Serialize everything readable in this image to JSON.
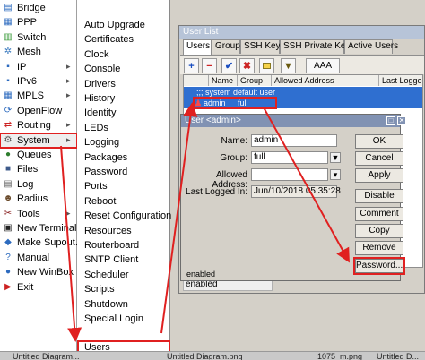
{
  "sidebar": {
    "items": [
      {
        "label": "Bridge",
        "icon": "bridge-icon",
        "glyph": "▤",
        "color": "#2d6bbf",
        "arrow": false
      },
      {
        "label": "PPP",
        "icon": "ppp-icon",
        "glyph": "▦",
        "color": "#2d6bbf",
        "arrow": false
      },
      {
        "label": "Switch",
        "icon": "switch-icon",
        "glyph": "▥",
        "color": "#3a9a3a",
        "arrow": false
      },
      {
        "label": "Mesh",
        "icon": "mesh-icon",
        "glyph": "✲",
        "color": "#3a7abf",
        "arrow": false
      },
      {
        "label": "IP",
        "icon": "ip-icon",
        "glyph": "▪",
        "color": "#2d6bbf",
        "arrow": true
      },
      {
        "label": "IPv6",
        "icon": "ipv6-icon",
        "glyph": "▪",
        "color": "#2d6bbf",
        "arrow": true
      },
      {
        "label": "MPLS",
        "icon": "mpls-icon",
        "glyph": "▦",
        "color": "#2d6bbf",
        "arrow": true
      },
      {
        "label": "OpenFlow",
        "icon": "openflow-icon",
        "glyph": "⟳",
        "color": "#2d6bbf",
        "arrow": false
      },
      {
        "label": "Routing",
        "icon": "routing-icon",
        "glyph": "⇄",
        "color": "#cc2222",
        "arrow": true
      },
      {
        "label": "System",
        "icon": "system-icon",
        "glyph": "⚙",
        "color": "#555555",
        "arrow": true
      },
      {
        "label": "Queues",
        "icon": "queues-icon",
        "glyph": "●",
        "color": "#2e7d2e",
        "arrow": false
      },
      {
        "label": "Files",
        "icon": "files-icon",
        "glyph": "■",
        "color": "#3d5a8a",
        "arrow": false
      },
      {
        "label": "Log",
        "icon": "log-icon",
        "glyph": "▤",
        "color": "#666666",
        "arrow": false
      },
      {
        "label": "Radius",
        "icon": "radius-icon",
        "glyph": "☻",
        "color": "#6a4a2a",
        "arrow": false
      },
      {
        "label": "Tools",
        "icon": "tools-icon",
        "glyph": "✂",
        "color": "#8a2222",
        "arrow": true
      },
      {
        "label": "New Terminal",
        "icon": "terminal-icon",
        "glyph": "▣",
        "color": "#222222",
        "arrow": false
      },
      {
        "label": "Make Supout.rif",
        "icon": "supout-icon",
        "glyph": "◆",
        "color": "#2d6bbf",
        "arrow": false
      },
      {
        "label": "Manual",
        "icon": "manual-icon",
        "glyph": "?",
        "color": "#2d6bbf",
        "arrow": false
      },
      {
        "label": "New WinBox",
        "icon": "winbox-icon",
        "glyph": "●",
        "color": "#2d6bbf",
        "arrow": false
      },
      {
        "label": "Exit",
        "icon": "exit-icon",
        "glyph": "▶",
        "color": "#cc2222",
        "arrow": false
      }
    ]
  },
  "submenu": {
    "items": [
      "Auto Upgrade",
      "Certificates",
      "Clock",
      "Console",
      "Drivers",
      "History",
      "Identity",
      "LEDs",
      "Logging",
      "Packages",
      "Password",
      "Ports",
      "Reboot",
      "Reset Configuration",
      "Resources",
      "Routerboard",
      "SNTP Client",
      "Scheduler",
      "Scripts",
      "Shutdown",
      "Special Login",
      "Users"
    ]
  },
  "user_list": {
    "title": "User List",
    "tabs": [
      "Users",
      "Groups",
      "SSH Keys",
      "SSH Private Keys",
      "Active Users"
    ],
    "find": "AAA",
    "columns": [
      "Name",
      "Group",
      "Allowed Address",
      "Last Logged"
    ],
    "comment_row": ";;; system default user",
    "rows": [
      {
        "name": "admin",
        "group": "full",
        "allowed": "",
        "last": ""
      }
    ],
    "status": "enabled"
  },
  "dialog": {
    "title": "User <admin>",
    "name_label": "Name:",
    "name_value": "admin",
    "group_label": "Group:",
    "group_value": "full",
    "allowed_label": "Allowed Address:",
    "allowed_value": "",
    "last_label": "Last Logged In:",
    "last_value": "Jun/10/2018 05:35:28",
    "buttons": [
      "OK",
      "Cancel",
      "Apply",
      "Disable",
      "Comment",
      "Copy",
      "Remove",
      "Password..."
    ],
    "status": "enabled"
  },
  "taskbar": {
    "items": [
      "Untitled Diagram...",
      "Untitled Diagram.png",
      "1075_m.png",
      "Untitled D..."
    ]
  },
  "colors": {
    "highlight": "#e02020",
    "selection": "#2f6fd0"
  }
}
